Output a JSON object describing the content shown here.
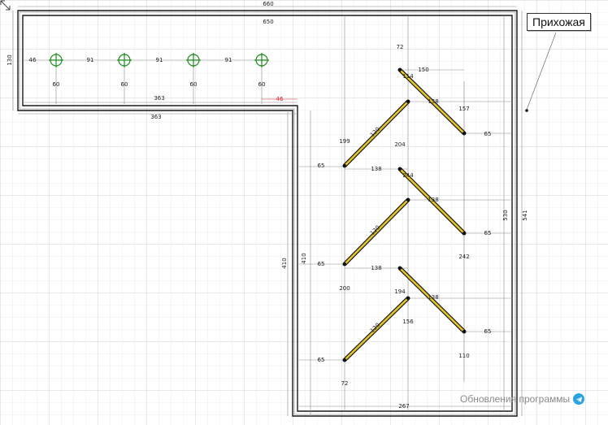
{
  "room_label": "Прихожая",
  "updates_label": "Обновления программы",
  "icons": {
    "telegram": "telegram-icon",
    "resize": "resize-corner-icon"
  },
  "colors": {
    "wall": "#1a1a1a",
    "grid": "#d9dde3",
    "dim": "#6b6b6b",
    "hanger": "#e5c52a",
    "hook": "#1f8a1f",
    "red_dim": "#cc2a2a"
  },
  "dims": {
    "outer_width": "660",
    "inner_width": "650",
    "top_height": "130",
    "offset_left": "46",
    "spacing": [
      "91",
      "91",
      "91"
    ],
    "hooks": [
      "60",
      "60",
      "60",
      "60"
    ],
    "inner_363": "363",
    "outer_363": "363",
    "red_46": "46",
    "d72_top": "72",
    "d150": "150",
    "d114": "114",
    "d138a": "138",
    "d157": "157",
    "d65a": "65",
    "d199": "199",
    "d120a": "120",
    "d204": "204",
    "d65b": "65",
    "d138b": "138",
    "d244": "244",
    "d138c": "138",
    "d65c": "65",
    "d120b": "120",
    "d242": "242",
    "d410a": "410",
    "d410b": "410",
    "d65d": "65",
    "d138d": "138",
    "d200": "200",
    "d194": "194",
    "d138e": "138",
    "d156": "156",
    "d120c": "120",
    "d65e": "65",
    "d65f": "65",
    "d110": "110",
    "d72_bottom": "72",
    "d267": "267",
    "d530": "530",
    "d541": "541"
  }
}
